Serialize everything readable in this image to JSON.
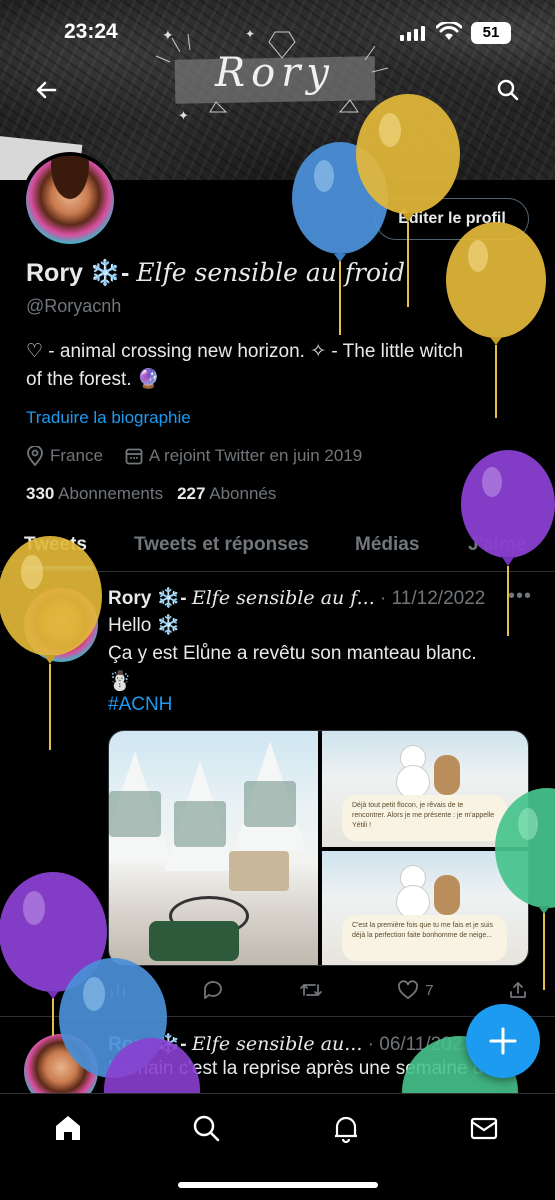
{
  "status_bar": {
    "time": "23:24",
    "battery": "51"
  },
  "banner": {
    "title": "Rory"
  },
  "profile": {
    "display_name": "Rory ❄️-",
    "display_name_styled": "Elfe sensible au froid",
    "handle": "@Roryacnh",
    "bio_line1": "♡ - animal crossing new horizon. ✧ - The little witch",
    "bio_line2": "of the forest. 🔮",
    "translate_label": "Traduire la biographie",
    "location": "France",
    "joined": "A rejoint Twitter en juin 2019",
    "following_count": "330",
    "following_label": "Abonnements",
    "followers_count": "227",
    "followers_label": "Abonnés",
    "edit_label": "Éditer le profil"
  },
  "tabs": [
    "Tweets",
    "Tweets et réponses",
    "Médias",
    "J'aime"
  ],
  "tweet1": {
    "author": "Rory ❄️-",
    "author_styled": "Elfe sensible au f...",
    "date": "· 11/12/2022",
    "line1": "Hello ❄️",
    "line2": "Ça y est Elůne a revêtu son manteau blanc.",
    "line3": "☃️",
    "hashtag": "#ACNH",
    "dialog1": "Déjà tout petit flocon, je rêvais de te rencontrer. Alors je me présente : je m'appelle Yétili !",
    "dialog2": "C'est la première fois que tu me fais et je suis déjà la perfection faite bonhomme de neige...",
    "likes": "7"
  },
  "tweet2": {
    "author": "Rory ❄️-",
    "author_styled": "Elfe sensible au...",
    "date": "· 06/11/2022",
    "text": "Demain c'est la reprise après une semaine de"
  },
  "colors": {
    "accent": "#1d9bf0",
    "muted": "#71767b",
    "background": "#000000"
  },
  "icons": [
    "back-arrow-icon",
    "search-icon",
    "location-pin-icon",
    "calendar-icon",
    "reply-icon",
    "retweet-icon",
    "heart-icon",
    "share-icon",
    "analytics-icon",
    "plus-icon",
    "home-icon",
    "bell-icon",
    "mail-icon"
  ]
}
